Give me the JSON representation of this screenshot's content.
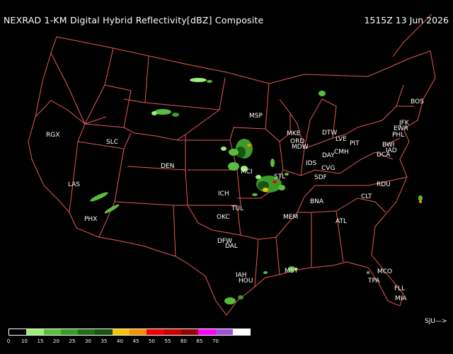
{
  "header": {
    "title": "NEXRAD 1-KM Digital Hybrid Reflectivity[dBZ] Composite",
    "timestamp": "1515Z 13 Jun 2026"
  },
  "colors": {
    "background": "#000000",
    "boundaries": "#e8585a",
    "labels": "#ffffff"
  },
  "stations": [
    "RGX",
    "SLC",
    "LAS",
    "PHX",
    "DEN",
    "MSP",
    "MKE",
    "DTW",
    "LVE",
    "PIT",
    "BOS",
    "JFK",
    "EWR",
    "PHL",
    "BWI",
    "IAD",
    "DCA",
    "ORD",
    "MDW",
    "IDS",
    "DAY",
    "CMH",
    "CVG",
    "SDF",
    "STL",
    "MCI",
    "ICH",
    "TUL",
    "OKC",
    "DFW",
    "DAL",
    "MEM",
    "BNA",
    "RDU",
    "CLT",
    "ATL",
    "IAH",
    "HOU",
    "MSY",
    "MCO",
    "TPA",
    "FLL",
    "MIA"
  ],
  "legend": {
    "colors": [
      "#ffffff",
      "#000000",
      "#9cee74",
      "#5bbd3c",
      "#3c9a28",
      "#236e19",
      "#155412",
      "#f5c400",
      "#f59000",
      "#f00000",
      "#c80000",
      "#960000",
      "#ff00ff",
      "#a650d8",
      "#ffffff"
    ],
    "ticks": [
      "0",
      "10",
      "15",
      "20",
      "25",
      "30",
      "35",
      "40",
      "45",
      "50",
      "55",
      "60",
      "65",
      "70"
    ]
  },
  "attribution": "SJU—>"
}
